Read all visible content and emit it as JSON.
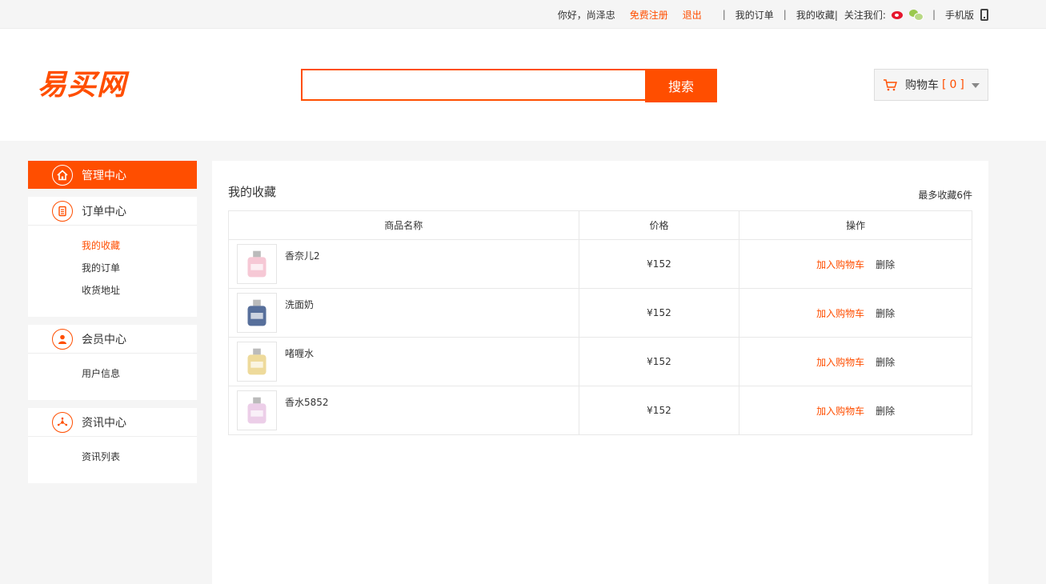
{
  "topbar": {
    "greeting": "你好，尚泽忠",
    "register": "免费注册",
    "logout": "退出",
    "sep1": "|",
    "my_orders": "我的订单",
    "sep2": "|",
    "my_favorites": "我的收藏|",
    "follow_us": "关注我们:",
    "sep3": "|",
    "mobile": "手机版"
  },
  "header": {
    "logo": "易买网",
    "search_value": "",
    "search_button": "搜索",
    "cart_label": "购物车",
    "cart_open": "[",
    "cart_count": "0",
    "cart_close": "]"
  },
  "sidebar": {
    "admin": "管理中心",
    "orders_section": "订单中心",
    "orders_links": [
      "我的收藏",
      "我的订单",
      "收货地址"
    ],
    "member_section": "会员中心",
    "member_links": [
      "用户信息"
    ],
    "news_section": "资讯中心",
    "news_links": [
      "资讯列表"
    ]
  },
  "main": {
    "title": "我的收藏",
    "note": "最多收藏6件",
    "columns": [
      "商品名称",
      "价格",
      "操作"
    ],
    "rows": [
      {
        "name": "香奈儿2",
        "price": "¥152",
        "add": "加入购物车",
        "del": "删除",
        "thumb_color": "#f3b6c7"
      },
      {
        "name": "洗面奶",
        "price": "¥152",
        "add": "加入购物车",
        "del": "删除",
        "thumb_color": "#1f3f7a"
      },
      {
        "name": "啫喱水",
        "price": "¥152",
        "add": "加入购物车",
        "del": "删除",
        "thumb_color": "#e8cd7a"
      },
      {
        "name": "香水5852",
        "price": "¥152",
        "add": "加入购物车",
        "del": "删除",
        "thumb_color": "#e5bde0"
      }
    ]
  },
  "colors": {
    "accent": "#ff4e00"
  },
  "icons": {
    "home": "home-icon",
    "order": "document-icon",
    "member": "user-icon",
    "news": "share-icon",
    "cart": "cart-icon",
    "weibo": "weibo-icon",
    "wechat": "wechat-icon",
    "phone": "phone-icon"
  }
}
